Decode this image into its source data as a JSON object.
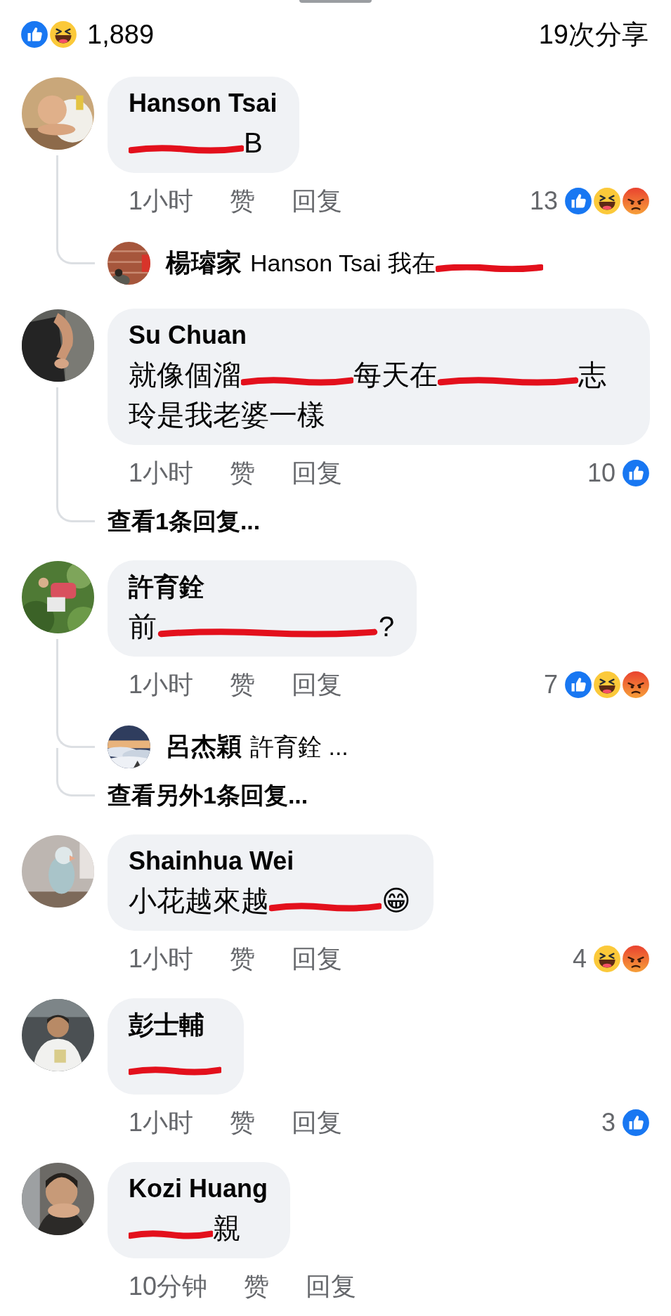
{
  "summary": {
    "reactions": [
      {
        "kind": "like"
      },
      {
        "kind": "haha"
      }
    ],
    "count": "1,889",
    "shares": "19次分享"
  },
  "comments": [
    {
      "author": "Hanson Tsai",
      "body": [
        {
          "kind": "scribble"
        },
        {
          "kind": "text",
          "text": "B"
        }
      ],
      "time": "1小时",
      "like_label": "赞",
      "reply_label": "回复",
      "reaction_count": "13",
      "reactions": [
        {
          "kind": "like"
        },
        {
          "kind": "haha"
        },
        {
          "kind": "angry"
        }
      ],
      "replies": [
        {
          "author": "楊璿家",
          "body": [
            {
              "kind": "text",
              "text": "Hanson Tsai 我在"
            },
            {
              "kind": "scribble"
            }
          ]
        }
      ]
    },
    {
      "author": "Su Chuan",
      "body": [
        {
          "kind": "text",
          "text": "就像個溜"
        },
        {
          "kind": "scribble"
        },
        {
          "kind": "text",
          "text": "每天在"
        },
        {
          "kind": "scribble"
        },
        {
          "kind": "text",
          "text": "志"
        },
        {
          "kind": "text",
          "text": "玲是我老婆一樣"
        }
      ],
      "time": "1小时",
      "like_label": "赞",
      "reply_label": "回复",
      "reaction_count": "10",
      "reactions": [
        {
          "kind": "like"
        }
      ],
      "more_replies": "查看1条回复..."
    },
    {
      "author": "許育銓",
      "body": [
        {
          "kind": "text",
          "text": "前"
        },
        {
          "kind": "scribble"
        },
        {
          "kind": "text",
          "text": "?"
        }
      ],
      "time": "1小时",
      "like_label": "赞",
      "reply_label": "回复",
      "reaction_count": "7",
      "reactions": [
        {
          "kind": "like"
        },
        {
          "kind": "haha"
        },
        {
          "kind": "angry"
        }
      ],
      "replies": [
        {
          "author": "呂杰穎",
          "body": [
            {
              "kind": "text",
              "text": "許育銓 ..."
            }
          ]
        }
      ],
      "more_replies": "查看另外1条回复..."
    },
    {
      "author": "Shainhua Wei",
      "body": [
        {
          "kind": "text",
          "text": "小花越來越"
        },
        {
          "kind": "scribble"
        },
        {
          "kind": "text",
          "text": "😁"
        }
      ],
      "time": "1小时",
      "like_label": "赞",
      "reply_label": "回复",
      "reaction_count": "4",
      "reactions": [
        {
          "kind": "haha"
        },
        {
          "kind": "angry"
        }
      ]
    },
    {
      "author": "彭士輔",
      "body": [
        {
          "kind": "scribble"
        }
      ],
      "time": "1小时",
      "like_label": "赞",
      "reply_label": "回复",
      "reaction_count": "3",
      "reactions": [
        {
          "kind": "like"
        }
      ]
    },
    {
      "author": "Kozi Huang",
      "body": [
        {
          "kind": "scribble"
        },
        {
          "kind": "text",
          "text": "親"
        }
      ],
      "time": "10分钟",
      "like_label": "赞",
      "reply_label": "回复"
    }
  ]
}
